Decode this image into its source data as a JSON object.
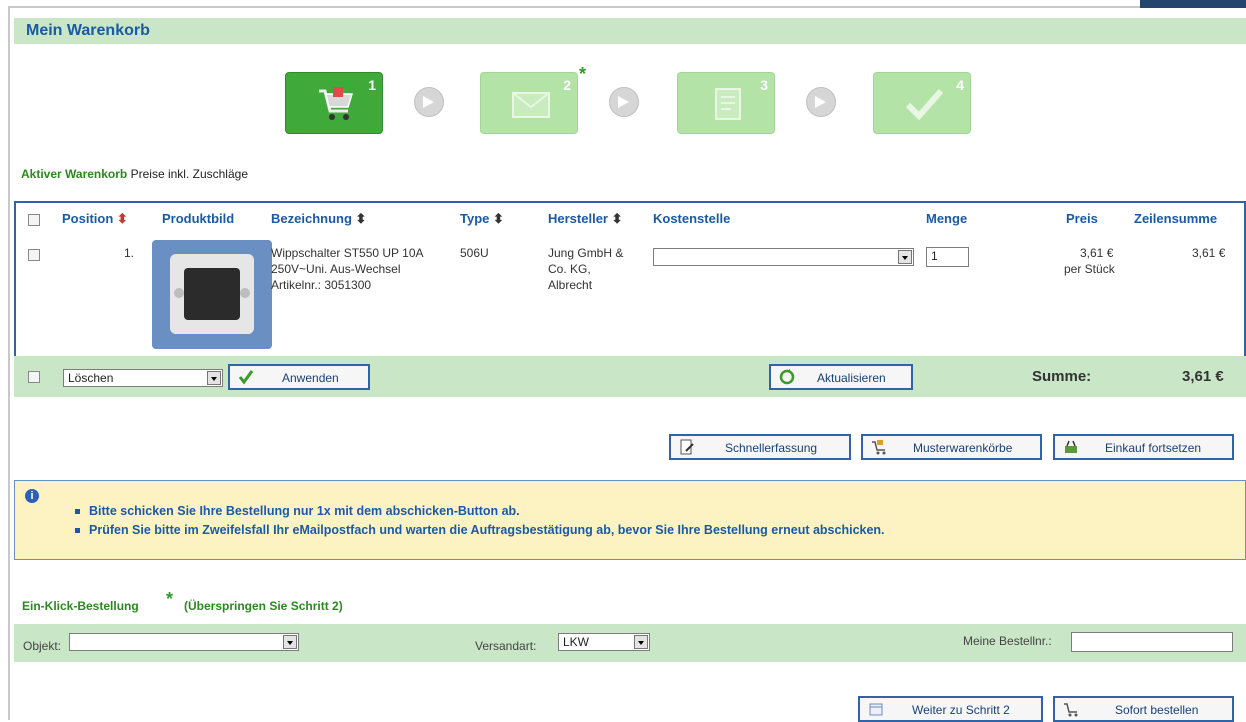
{
  "page": {
    "title": "Mein Warenkorb"
  },
  "steps": [
    {
      "number": "1",
      "icon": "cart-icon",
      "active": true
    },
    {
      "number": "2",
      "icon": "envelope-icon",
      "active": false,
      "star": "*"
    },
    {
      "number": "3",
      "icon": "document-icon",
      "active": false
    },
    {
      "number": "4",
      "icon": "checkmark-icon",
      "active": false
    }
  ],
  "cart": {
    "heading": "Aktiver Warenkorb",
    "subheading": "Preise inkl. Zuschläge",
    "columns": {
      "position": "Position",
      "image": "Produktbild",
      "name": "Bezeichnung",
      "type": "Type",
      "manufacturer": "Hersteller",
      "cost_center": "Kostenstelle",
      "quantity": "Menge",
      "price": "Preis",
      "line_total": "Zeilensumme"
    },
    "sort_glyph": "⬍",
    "rows": [
      {
        "position": "1.",
        "name_line1": "Wippschalter ST550 UP 10A",
        "name_line2": "250V~Uni. Aus-Wechsel",
        "article": "Artikelnr.: 3051300",
        "type": "506U",
        "manufacturer_line1": "Jung GmbH &",
        "manufacturer_line2": "Co. KG,",
        "manufacturer_line3": "Albrecht",
        "cost_center": "",
        "quantity": "1",
        "price": "3,61 €",
        "price_unit": "per Stück",
        "line_total": "3,61 €"
      }
    ]
  },
  "actions": {
    "bulk_select": "Löschen",
    "apply": "Anwenden",
    "update": "Aktualisieren",
    "sum_label": "Summe:",
    "sum_value": "3,61 €"
  },
  "buttons": {
    "quick_entry": "Schnellerfassung",
    "template_carts": "Musterwarenkörbe",
    "continue_shopping": "Einkauf fortsetzen",
    "next_step": "Weiter zu Schritt 2",
    "order_now": "Sofort bestellen"
  },
  "info": {
    "icon": "info-icon",
    "lines": [
      "Bitte schicken Sie Ihre Bestellung nur 1x mit dem abschicken-Button ab.",
      "Prüfen Sie bitte im Zweifelsfall Ihr eMailpostfach und warten die Auftragsbestätigung ab, bevor Sie Ihre Bestellung erneut abschicken."
    ]
  },
  "oneclick": {
    "title": "Ein-Klick-Bestellung",
    "star": "*",
    "note": "(Überspringen Sie Schritt 2)",
    "object_label": "Objekt:",
    "object_value": "",
    "shipping_label": "Versandart:",
    "shipping_value": "LKW",
    "order_no_label": "Meine Bestellnr.:",
    "order_no_value": ""
  },
  "colors": {
    "accent_blue": "#1a5aa6",
    "accent_green": "#2a8a1e",
    "bar_green": "#c9e6c6",
    "info_yellow": "#fdf3c2"
  }
}
